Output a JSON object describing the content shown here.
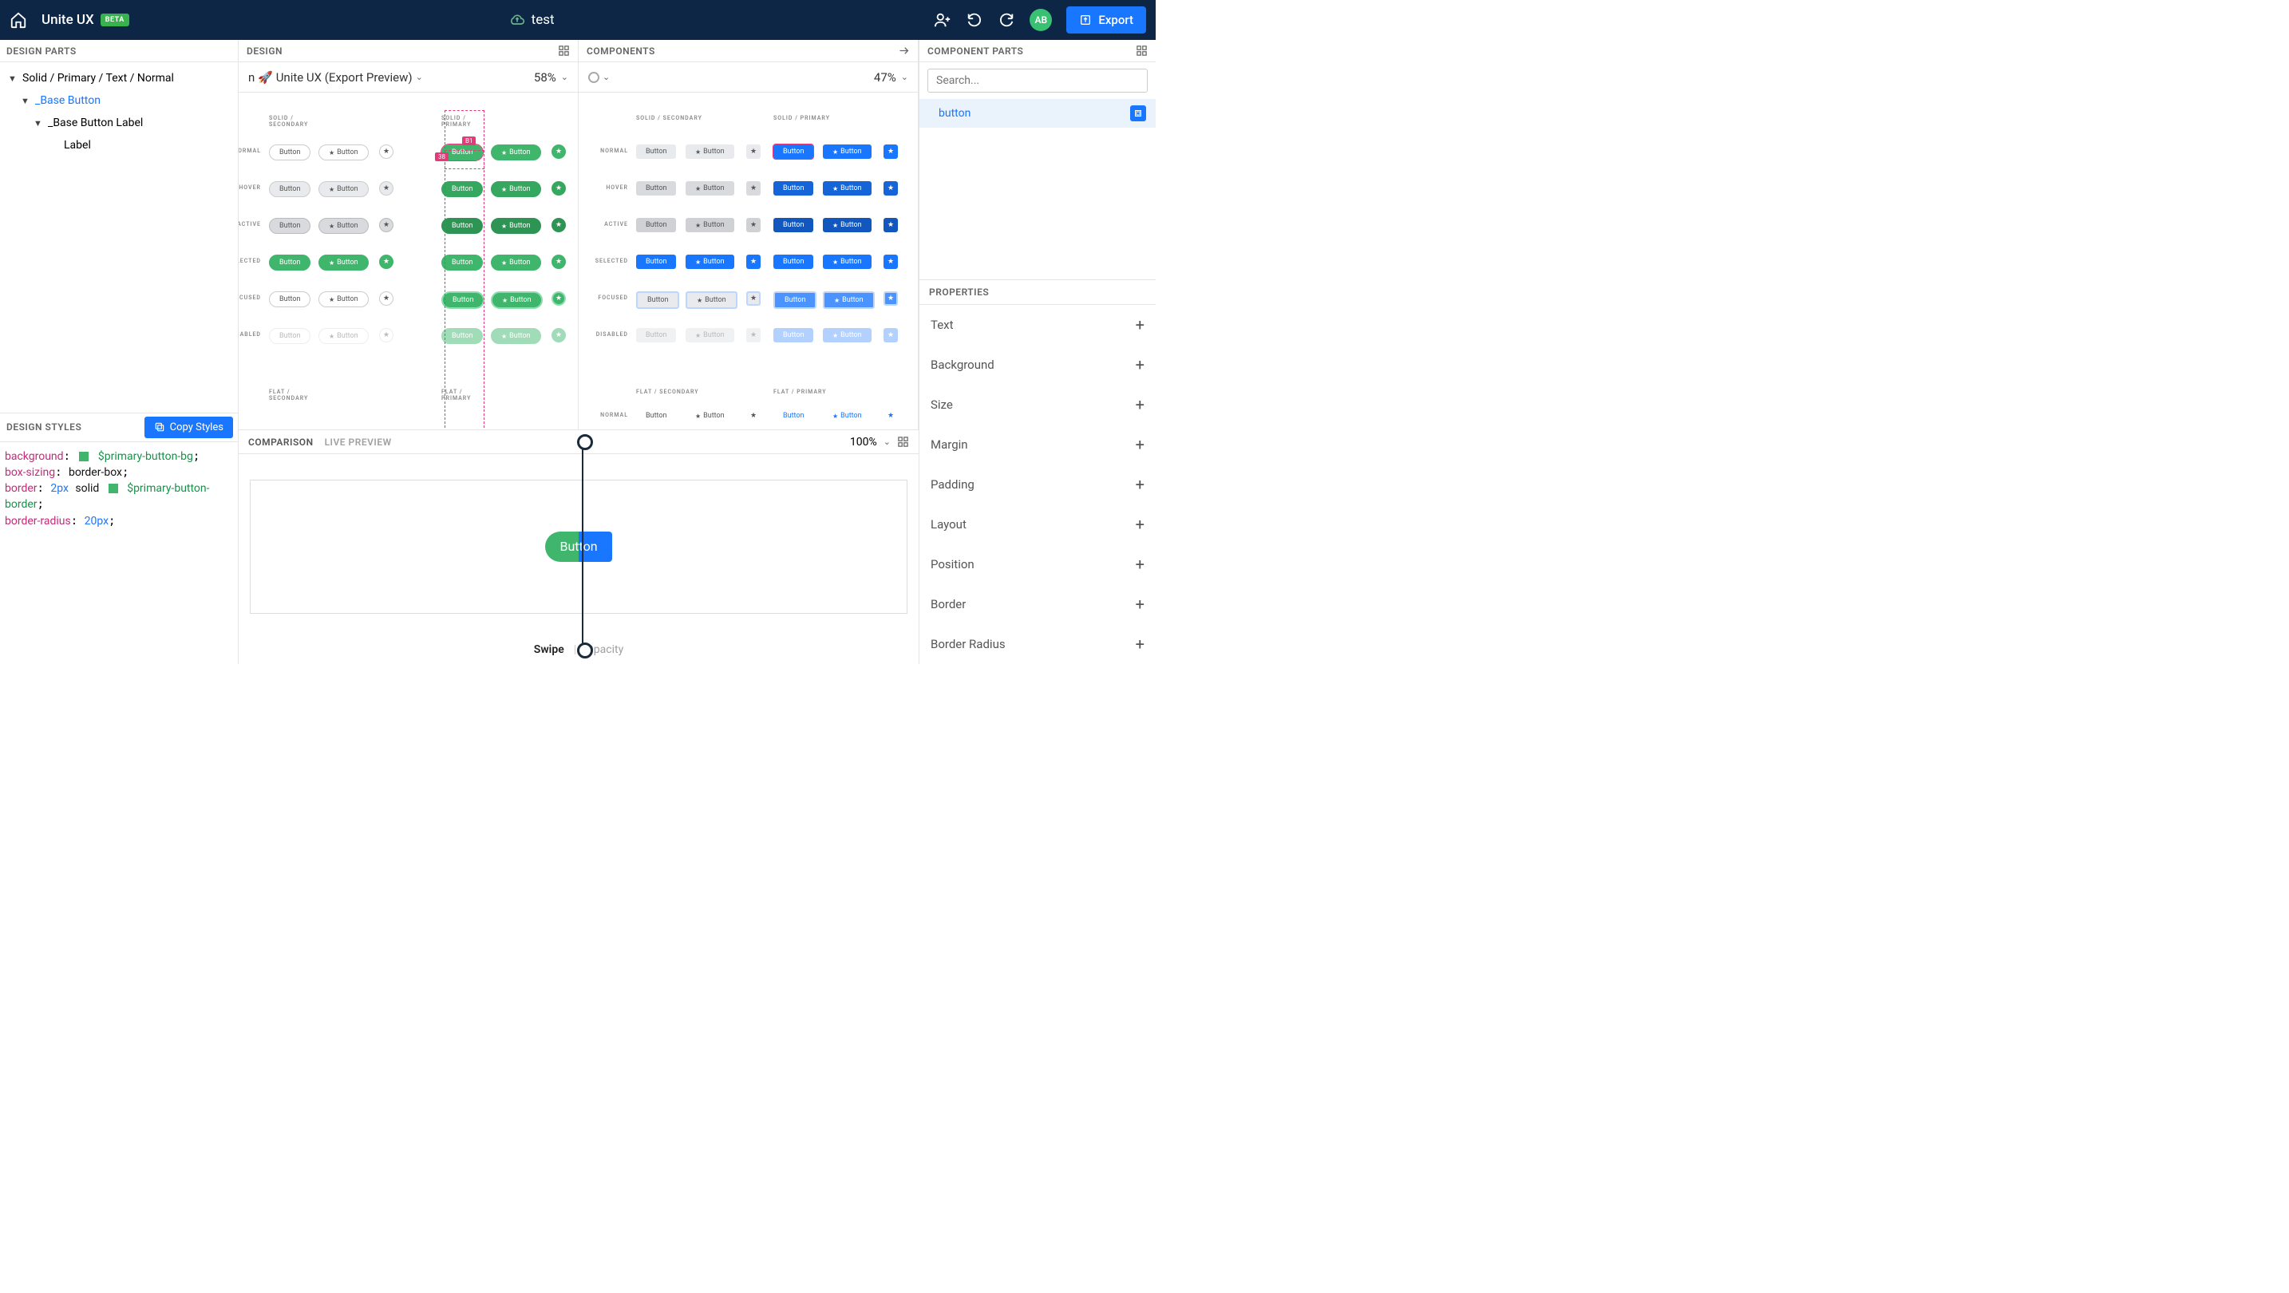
{
  "topbar": {
    "brand": "Unite UX",
    "beta": "BETA",
    "project": "test",
    "avatar": "AB",
    "export": "Export"
  },
  "left": {
    "parts_title": "DESIGN PARTS",
    "tree": {
      "root": "Solid / Primary / Text / Normal",
      "l1": "_Base Button",
      "l2": "_Base Button Label",
      "l3": "Label"
    },
    "styles_title": "DESIGN STYLES",
    "copy_btn": "Copy Styles",
    "styles": {
      "p1": "background",
      "v1": "$primary-button-bg",
      "p2": "box-sizing",
      "v2": "border-box",
      "p3": "border",
      "v3a": "2px",
      "v3b": "solid",
      "v3c": "$primary-button-border",
      "p4": "border-radius",
      "v4": "20px"
    },
    "swatch1": "#3fb66c",
    "swatch2": "#3fb66c"
  },
  "center": {
    "design_title": "DESIGN",
    "components_title": "COMPONENTS",
    "design_crumb_prefix": "n 🚀 ",
    "design_crumb": "Unite UX (Export Preview)",
    "design_zoom": "58%",
    "components_zoom": "47%",
    "sel_badge_top": "B1",
    "sel_badge_left": "38",
    "sections": {
      "solid_secondary": "SOLID / SECONDARY",
      "solid_primary": "SOLID / PRIMARY",
      "flat_secondary": "FLAT / SECONDARY",
      "flat_primary": "FLAT / PRIMARY"
    },
    "rows": [
      "NORMAL",
      "HOVER",
      "ACTIVE",
      "SELECTED",
      "FOCUSED",
      "DISABLED"
    ],
    "btn_label": "Button",
    "comparison": {
      "tab1": "COMPARISON",
      "tab2": "LIVE PREVIEW",
      "zoom": "100%",
      "preview_label": "Button",
      "mode_swipe": "Swipe",
      "mode_opacity": "Opacity"
    }
  },
  "right": {
    "parts_title": "COMPONENT PARTS",
    "search_placeholder": "Search...",
    "selected_part": "button",
    "properties_title": "PROPERTIES",
    "props": [
      "Text",
      "Background",
      "Size",
      "Margin",
      "Padding",
      "Layout",
      "Position",
      "Border",
      "Border Radius"
    ]
  }
}
